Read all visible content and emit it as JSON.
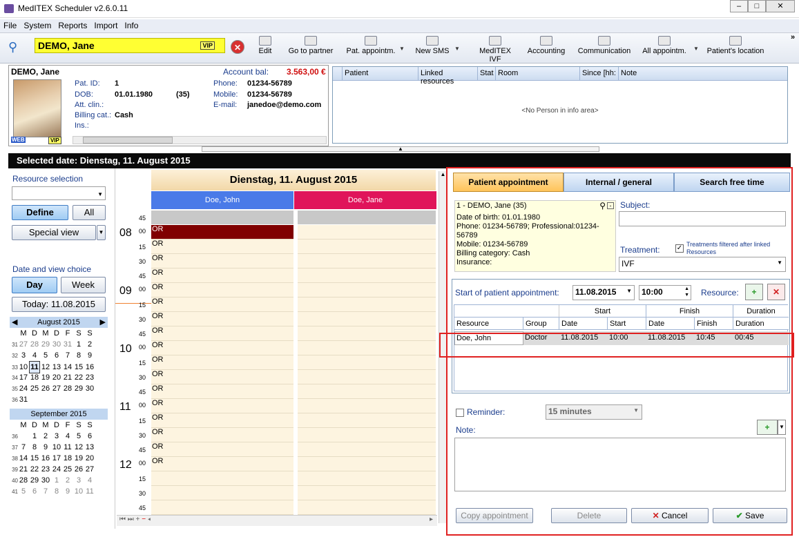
{
  "window": {
    "title": "MedITEX  Scheduler  v2.6.0.11"
  },
  "menu": [
    "File",
    "System",
    "Reports",
    "Import",
    "Info"
  ],
  "toolbar": {
    "patient": "DEMO, Jane",
    "vip": "VIP",
    "edit": "Edit",
    "go_partner": "Go to partner",
    "pat_appointm": "Pat. appointm.",
    "new_sms": "New SMS",
    "meditex_ivf": "MedITEX IVF",
    "accounting": "Accounting",
    "communication": "Communication",
    "all_appointm": "All appointm.",
    "patients_location": "Patient's location"
  },
  "patient": {
    "name": "DEMO, Jane",
    "account_bal_label": "Account bal:",
    "account_bal": "3.563,00 €",
    "pat_id_label": "Pat. ID:",
    "pat_id": "1",
    "dob_label": "DOB:",
    "dob": "01.01.1980",
    "age": "(35)",
    "att_label": "Att. clin.:",
    "billing_label": "Billing cat.:",
    "billing": "Cash",
    "ins_label": "Ins.:",
    "phone_label": "Phone:",
    "phone": "01234-56789",
    "mobile_label": "Mobile:",
    "mobile": "01234-56789",
    "email_label": "E-mail:",
    "email": "janedoe@demo.com",
    "web": "WEB",
    "vip": "VIP"
  },
  "info_grid": {
    "columns": [
      "Patient",
      "Linked resources",
      "Stat",
      "Room",
      "Since [hh:",
      "Note"
    ],
    "empty": "<No Person in info area>"
  },
  "selected_date": "Selected date:  Dienstag, 11. August 2015",
  "left": {
    "resource_selection": "Resource selection",
    "define": "Define",
    "all": "All",
    "special_view": "Special view",
    "date_view_choice": "Date and view choice",
    "day": "Day",
    "week": "Week",
    "today": "Today: 11.08.2015"
  },
  "cal_aug": {
    "title": "August 2015",
    "days": [
      "M",
      "D",
      "M",
      "D",
      "F",
      "S",
      "S"
    ],
    "rows": [
      {
        "wk": "31",
        "d": [
          "27",
          "28",
          "29",
          "30",
          "31",
          "1",
          "2"
        ]
      },
      {
        "wk": "32",
        "d": [
          "3",
          "4",
          "5",
          "6",
          "7",
          "8",
          "9"
        ]
      },
      {
        "wk": "33",
        "d": [
          "10",
          "11",
          "12",
          "13",
          "14",
          "15",
          "16"
        ]
      },
      {
        "wk": "34",
        "d": [
          "17",
          "18",
          "19",
          "20",
          "21",
          "22",
          "23"
        ]
      },
      {
        "wk": "35",
        "d": [
          "24",
          "25",
          "26",
          "27",
          "28",
          "29",
          "30"
        ]
      },
      {
        "wk": "36",
        "d": [
          "31",
          "",
          "",
          "",
          "",
          "",
          ""
        ]
      }
    ]
  },
  "cal_sep": {
    "title": "September 2015",
    "days": [
      "M",
      "D",
      "M",
      "D",
      "F",
      "S",
      "S"
    ],
    "rows": [
      {
        "wk": "36",
        "d": [
          "",
          "1",
          "2",
          "3",
          "4",
          "5",
          "6"
        ]
      },
      {
        "wk": "37",
        "d": [
          "7",
          "8",
          "9",
          "10",
          "11",
          "12",
          "13"
        ]
      },
      {
        "wk": "38",
        "d": [
          "14",
          "15",
          "16",
          "17",
          "18",
          "19",
          "20"
        ]
      },
      {
        "wk": "39",
        "d": [
          "21",
          "22",
          "23",
          "24",
          "25",
          "26",
          "27"
        ]
      },
      {
        "wk": "40",
        "d": [
          "28",
          "29",
          "30",
          "1",
          "2",
          "3",
          "4"
        ]
      },
      {
        "wk": "41",
        "d": [
          "5",
          "6",
          "7",
          "8",
          "9",
          "10",
          "11"
        ]
      }
    ]
  },
  "schedule": {
    "date": "Dienstag, 11. August 2015",
    "res1": "Doe, John",
    "res2": "Doe, Jane",
    "slot_label": "OR",
    "times": [
      {
        "h": "",
        "m": "45"
      },
      {
        "h": "08",
        "m": "00"
      },
      {
        "h": "",
        "m": "15"
      },
      {
        "h": "",
        "m": "30"
      },
      {
        "h": "",
        "m": "45"
      },
      {
        "h": "09",
        "m": "00"
      },
      {
        "h": "",
        "m": "15"
      },
      {
        "h": "",
        "m": "30"
      },
      {
        "h": "",
        "m": "45"
      },
      {
        "h": "10",
        "m": "00"
      },
      {
        "h": "",
        "m": "15"
      },
      {
        "h": "",
        "m": "30"
      },
      {
        "h": "",
        "m": "45"
      },
      {
        "h": "11",
        "m": "00"
      },
      {
        "h": "",
        "m": "15"
      },
      {
        "h": "",
        "m": "30"
      },
      {
        "h": "",
        "m": "45"
      },
      {
        "h": "12",
        "m": "00"
      },
      {
        "h": "",
        "m": "15"
      },
      {
        "h": "",
        "m": "30"
      },
      {
        "h": "",
        "m": "45"
      }
    ]
  },
  "form": {
    "tab1": "Patient appointment",
    "tab2": "Internal / general",
    "tab3": "Search free time",
    "pat_line": "1 - DEMO, Jane (35)",
    "pat_info": [
      "Date of birth: 01.01.1980",
      "Phone: 01234-56789; Professional:01234-56789",
      "Mobile: 01234-56789",
      "Billing category: Cash",
      "Insurance:"
    ],
    "subject_label": "Subject:",
    "treatment_label": "Treatment:",
    "treat_filter": "Treatments filtered after linked Resources",
    "treatment": "IVF",
    "start_label": "Start of patient appointment:",
    "start_date": "11.08.2015",
    "start_time": "10:00",
    "resource_label": "Resource:",
    "grp_start": "Start",
    "grp_finish": "Finish",
    "grp_duration": "Duration",
    "cols": [
      "Resource",
      "Group",
      "Date",
      "Start",
      "Date",
      "Finish",
      "Duration"
    ],
    "row": [
      "Doe, John",
      "Doctor",
      "11.08.2015",
      "10:00",
      "11.08.2015",
      "10:45",
      "00:45"
    ],
    "reminder_label": "Reminder:",
    "reminder": "15 minutes",
    "note_label": "Note:",
    "copy": "Copy appointment",
    "delete": "Delete",
    "cancel": "Cancel",
    "save": "Save"
  }
}
